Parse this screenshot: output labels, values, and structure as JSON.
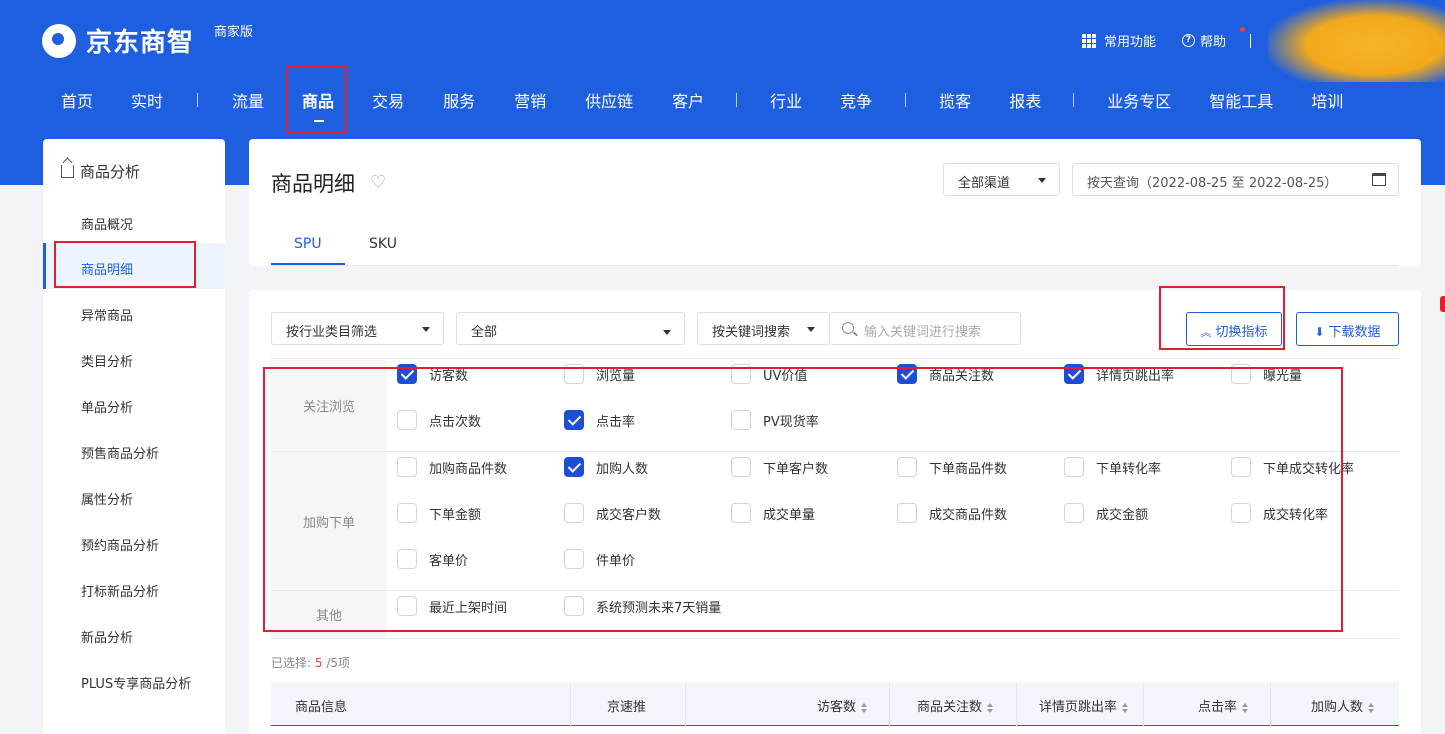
{
  "header": {
    "logo": "京东商智",
    "edition": "商家版",
    "common_functions": "常用功能",
    "help": "帮助",
    "nav": [
      "首页",
      "实时",
      "流量",
      "商品",
      "交易",
      "服务",
      "营销",
      "供应链",
      "客户",
      "行业",
      "竞争",
      "揽客",
      "报表",
      "业务专区",
      "智能工具",
      "培训"
    ],
    "active_nav": "商品"
  },
  "sidebar": {
    "title": "商品分析",
    "items": [
      "商品概况",
      "商品明细",
      "异常商品",
      "类目分析",
      "单品分析",
      "预售商品分析",
      "属性分析",
      "预约商品分析",
      "打标新品分析",
      "新品分析",
      "PLUS专享商品分析"
    ],
    "active": "商品明细"
  },
  "page": {
    "title": "商品明细",
    "channel": "全部渠道",
    "date_range": "按天查询（2022-08-25 至 2022-08-25）",
    "tabs": [
      "SPU",
      "SKU"
    ],
    "active_tab": "SPU"
  },
  "filters": {
    "category_filter": "按行业类目筛选",
    "category_value": "全部",
    "keyword_mode": "按关键词搜索",
    "search_placeholder": "输入关键词进行搜索",
    "toggle_metrics": "切换指标",
    "download": "下载数据"
  },
  "metric_groups": [
    {
      "label": "关注浏览",
      "rows": [
        [
          {
            "name": "访客数",
            "checked": true
          },
          {
            "name": "浏览量",
            "checked": false
          },
          {
            "name": "UV价值",
            "checked": false
          },
          {
            "name": "商品关注数",
            "checked": true
          },
          {
            "name": "详情页跳出率",
            "checked": true
          },
          {
            "name": "曝光量",
            "checked": false
          }
        ],
        [
          {
            "name": "点击次数",
            "checked": false
          },
          {
            "name": "点击率",
            "checked": true
          },
          {
            "name": "PV现货率",
            "checked": false
          }
        ]
      ]
    },
    {
      "label": "加购下单",
      "rows": [
        [
          {
            "name": "加购商品件数",
            "checked": false
          },
          {
            "name": "加购人数",
            "checked": true
          },
          {
            "name": "下单客户数",
            "checked": false
          },
          {
            "name": "下单商品件数",
            "checked": false
          },
          {
            "name": "下单转化率",
            "checked": false
          },
          {
            "name": "下单成交转化率",
            "checked": false
          }
        ],
        [
          {
            "name": "下单金额",
            "checked": false
          },
          {
            "name": "成交客户数",
            "checked": false
          },
          {
            "name": "成交单量",
            "checked": false
          },
          {
            "name": "成交商品件数",
            "checked": false
          },
          {
            "name": "成交金额",
            "checked": false
          },
          {
            "name": "成交转化率",
            "checked": false
          }
        ],
        [
          {
            "name": "客单价",
            "checked": false
          },
          {
            "name": "件单价",
            "checked": false
          }
        ]
      ]
    },
    {
      "label": "其他",
      "rows": [
        [
          {
            "name": "最近上架时间",
            "checked": false
          },
          {
            "name": "系统预测未来7天销量",
            "checked": false
          }
        ]
      ]
    }
  ],
  "selection": {
    "prefix": "已选择:",
    "count": "5",
    "total": "/5项"
  },
  "table": {
    "columns": [
      "商品信息",
      "京速推",
      "访客数",
      "商品关注数",
      "详情页跳出率",
      "点击率",
      "加购人数"
    ]
  },
  "colors": {
    "brand": "#1e5fe0",
    "checkbox_on": "#1d4ed8",
    "annotation": "#e0202a"
  }
}
